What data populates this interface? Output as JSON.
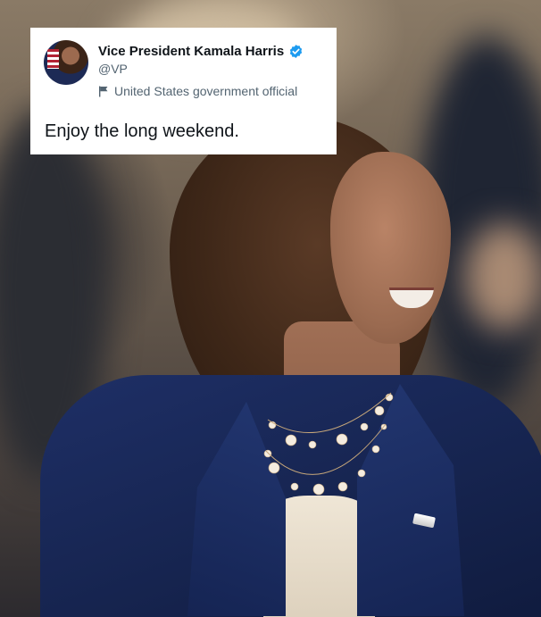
{
  "tweet": {
    "author_name": "Vice President Kamala Harris",
    "handle": "@VP",
    "affiliation": "United States government official",
    "text": "Enjoy the long weekend.",
    "verified_color": "#1d9bf0"
  },
  "icons": {
    "verified": "verified-badge-icon",
    "affiliation": "flag-icon"
  },
  "photo": {
    "subject": "smiling woman in navy blazer with pearl necklaces"
  }
}
